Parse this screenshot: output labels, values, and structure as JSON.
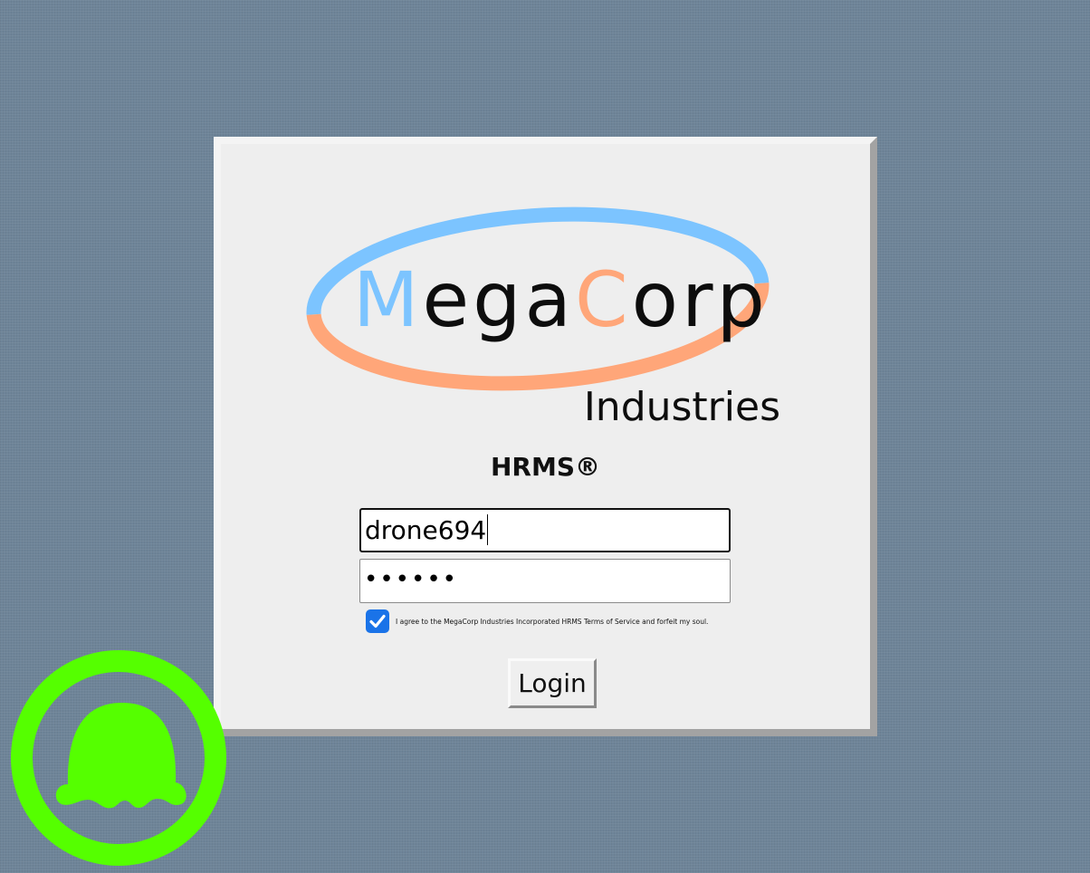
{
  "logo": {
    "name_part1": "M",
    "name_part2": "ega",
    "name_part3": "C",
    "name_part4": "orp",
    "subtitle": "Industries",
    "colors": {
      "blue": "#7cc4ff",
      "orange": "#ffa679",
      "text": "#0d0d0d"
    }
  },
  "app": {
    "title": "HRMS®"
  },
  "form": {
    "username_value": "drone694",
    "password_value": "••••••",
    "terms_checked": true,
    "terms_text": "I agree to the MegaCorp Industries Incorporated HRMS Terms of Service and forfeit my soul.",
    "login_label": "Login"
  },
  "colors": {
    "background": "#6e8498",
    "panel": "#eeeeee",
    "checkbox": "#1a73e8",
    "badge": "#55ff00"
  },
  "icons": {
    "checkbox": "checkmark-icon",
    "corner_badge": "ghost-icon"
  }
}
